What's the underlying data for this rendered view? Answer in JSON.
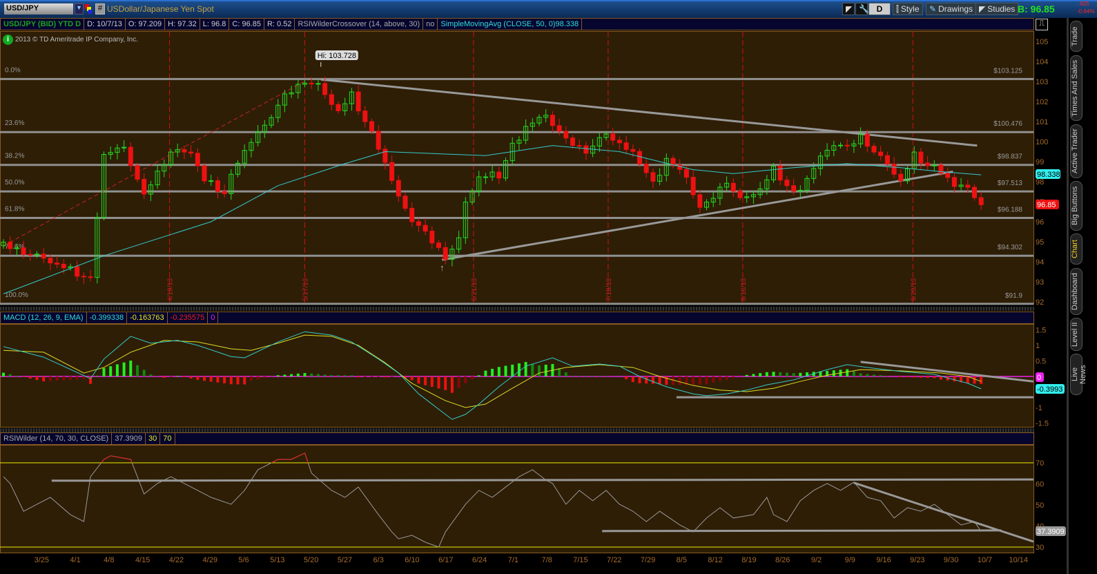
{
  "toolbar": {
    "symbol": "USD/JPY",
    "description": "USDollar/Japanese Yen Spot",
    "hash": "#",
    "period_button": "D",
    "style": "Style",
    "drawings": "Drawings",
    "studies": "Studies",
    "bid": "B: 96.85",
    "change": ".625",
    "change_pct": "-0.64%"
  },
  "info_bar": {
    "symbol": "USD/JPY (BID) YTD D",
    "date": "D: 10/7/13",
    "open": "O: 97.209",
    "high": "H: 97.32",
    "low": "L: 96.8",
    "close": "C: 96.85",
    "range": "R: 0.52",
    "study1": "RSIWilderCrossover (14, above, 30)",
    "study1_val": "no",
    "study2": "SimpleMovingAvg (CLOSE, 50, 0)98.338"
  },
  "copyright": "2013 © TD Ameritrade IP Company, Inc.",
  "side_tabs": [
    "Trade",
    "Times And Sales",
    "Active Trader",
    "Big Buttons",
    "Chart",
    "Dashboard",
    "Level II",
    "Live News"
  ],
  "colors": {
    "bg": "#2e1e06",
    "up": "#22dd22",
    "down": "#ee1111",
    "sma": "#33cccc",
    "signal": "#dddd22",
    "fib": "#909090",
    "accent": "#f0d020"
  },
  "chart_data": [
    {
      "type": "candlestick",
      "title": "USD/JPY daily",
      "ylim": [
        92,
        105
      ],
      "yticks": [
        105,
        104,
        103,
        102,
        101,
        100,
        99,
        98,
        97,
        96,
        95,
        94,
        93,
        92
      ],
      "date_labels": [
        "3/25",
        "4/1",
        "4/8",
        "4/15",
        "4/22",
        "4/29",
        "5/6",
        "5/13",
        "5/20",
        "5/27",
        "6/3",
        "6/10",
        "6/17",
        "6/24",
        "7/1",
        "7/8",
        "7/15",
        "7/22",
        "7/29",
        "8/5",
        "8/12",
        "8/19",
        "8/26",
        "9/2",
        "9/9",
        "9/16",
        "9/23",
        "9/30",
        "10/7",
        "10/14"
      ],
      "close_anchors": [
        [
          0,
          94.8
        ],
        [
          6,
          94.3
        ],
        [
          11,
          93.4
        ],
        [
          13,
          93.1
        ],
        [
          14,
          96.4
        ],
        [
          15,
          99.3
        ],
        [
          18,
          99.6
        ],
        [
          21,
          97.2
        ],
        [
          22,
          97.9
        ],
        [
          25,
          99.6
        ],
        [
          28,
          99.6
        ],
        [
          30,
          98.1
        ],
        [
          33,
          97.4
        ],
        [
          35,
          99.1
        ],
        [
          39,
          100.7
        ],
        [
          42,
          102.2
        ],
        [
          45,
          103.1
        ],
        [
          47,
          102.9
        ],
        [
          50,
          101.6
        ],
        [
          52,
          102.3
        ],
        [
          54,
          101
        ],
        [
          56,
          99.8
        ],
        [
          59,
          97.1
        ],
        [
          61,
          96
        ],
        [
          62,
          95.7
        ],
        [
          64,
          95
        ],
        [
          66,
          94.3
        ],
        [
          68,
          95.2
        ],
        [
          69,
          97.1
        ],
        [
          71,
          98.3
        ],
        [
          74,
          98.3
        ],
        [
          76,
          99.8
        ],
        [
          78,
          100.7
        ],
        [
          81,
          101.2
        ],
        [
          84,
          100
        ],
        [
          87,
          99.6
        ],
        [
          90,
          100.5
        ],
        [
          92,
          100
        ],
        [
          95,
          99
        ],
        [
          97,
          97.9
        ],
        [
          99,
          99.1
        ],
        [
          102,
          98.1
        ],
        [
          104,
          96.6
        ],
        [
          105,
          96.8
        ],
        [
          108,
          98.1
        ],
        [
          110,
          97.2
        ],
        [
          113,
          97.7
        ],
        [
          115,
          98.6
        ],
        [
          118,
          97.4
        ],
        [
          120,
          98.1
        ],
        [
          122,
          99.1
        ],
        [
          124,
          99.8
        ],
        [
          126,
          99.6
        ],
        [
          128,
          100.3
        ],
        [
          130,
          99.6
        ],
        [
          132,
          99
        ],
        [
          134,
          98.1
        ],
        [
          136,
          99.3
        ],
        [
          138,
          98.8
        ],
        [
          140,
          98.6
        ],
        [
          142,
          97.7
        ],
        [
          144,
          97.6
        ],
        [
          145,
          97.2
        ],
        [
          146,
          96.85
        ]
      ],
      "sma50_anchors": [
        [
          0,
          92.4
        ],
        [
          15,
          94.3
        ],
        [
          31,
          96
        ],
        [
          41,
          97.8
        ],
        [
          51,
          98.9
        ],
        [
          57,
          99.5
        ],
        [
          72,
          99.3
        ],
        [
          82,
          99.8
        ],
        [
          92,
          99.5
        ],
        [
          98,
          99
        ],
        [
          103,
          98.6
        ],
        [
          109,
          98.4
        ],
        [
          118,
          98.7
        ],
        [
          126,
          98.9
        ],
        [
          134,
          98.7
        ],
        [
          140,
          98.5
        ],
        [
          146,
          98.34
        ]
      ],
      "fib_levels": [
        {
          "pct": "0.0%",
          "price": 103.125,
          "label": "$103.125"
        },
        {
          "pct": "23.6%",
          "price": 100.476,
          "label": "$100.476"
        },
        {
          "pct": "38.2%",
          "price": 98.837,
          "label": "$98.837"
        },
        {
          "pct": "50.0%",
          "price": 97.513,
          "label": "$97.513"
        },
        {
          "pct": "61.8%",
          "price": 96.188,
          "label": "$96.188"
        },
        {
          "pct": "78.6%",
          "price": 94.302,
          "label": "$94.302"
        },
        {
          "pct": "100.0%",
          "price": 91.9,
          "label": "$91.9"
        }
      ],
      "month_markers": [
        {
          "day": 24.8,
          "label": "4/19/13"
        },
        {
          "day": 45,
          "label": "5/17/13"
        },
        {
          "day": 70.2,
          "label": "6/21/13"
        },
        {
          "day": 90.3,
          "label": "7/19/13"
        },
        {
          "day": 110.4,
          "label": "8/16/13"
        },
        {
          "day": 135.8,
          "label": "9/20/13"
        }
      ],
      "trendlines": [
        [
          [
            47.4,
            103.1
          ],
          [
            145.4,
            99.8
          ]
        ],
        [
          [
            65.5,
            94.1
          ],
          [
            141.8,
            98.5
          ]
        ]
      ],
      "dashed_trendline": [
        [
          0,
          94.8
        ],
        [
          44.9,
          103
        ]
      ],
      "high": {
        "day": 47.4,
        "price": 103.728,
        "label": "Hi: 103.728"
      },
      "sma_badge": "98.338",
      "last_badge": "96.85"
    },
    {
      "type": "line",
      "title": "MACD (12, 26, 9, EMA)",
      "values": [
        "-0.399338",
        "-0.163763",
        "-0.235575",
        "0"
      ],
      "ylim": [
        -1.5,
        1.5
      ],
      "yticks": [
        "1.5",
        "1",
        "0.5",
        "0",
        "-0.5",
        "-1",
        "-1.5"
      ],
      "macd_anchors": [
        [
          0,
          0.96
        ],
        [
          6,
          0.62
        ],
        [
          13,
          -0.07
        ],
        [
          15,
          0.56
        ],
        [
          19,
          1.29
        ],
        [
          22,
          1.07
        ],
        [
          26,
          1.16
        ],
        [
          29,
          1.0
        ],
        [
          34,
          0.64
        ],
        [
          36,
          0.6
        ],
        [
          41,
          1.11
        ],
        [
          45,
          1.44
        ],
        [
          49,
          1.33
        ],
        [
          52,
          1.11
        ],
        [
          56,
          0.56
        ],
        [
          59,
          0.11
        ],
        [
          62,
          -0.56
        ],
        [
          66,
          -1.22
        ],
        [
          67,
          -1.38
        ],
        [
          69,
          -1.22
        ],
        [
          71,
          -0.89
        ],
        [
          74,
          -0.33
        ],
        [
          78,
          0.33
        ],
        [
          82,
          0.6
        ],
        [
          85,
          0.33
        ],
        [
          89,
          0.4
        ],
        [
          92,
          0.33
        ],
        [
          95,
          0
        ],
        [
          99,
          -0.33
        ],
        [
          103,
          -0.56
        ],
        [
          105,
          -0.62
        ],
        [
          108,
          -0.56
        ],
        [
          111,
          -0.44
        ],
        [
          114,
          -0.27
        ],
        [
          118,
          -0.11
        ],
        [
          123,
          0.22
        ],
        [
          126,
          0.38
        ],
        [
          129,
          0.29
        ],
        [
          134,
          0.16
        ],
        [
          139,
          0.07
        ],
        [
          144,
          -0.22
        ],
        [
          146,
          -0.4
        ]
      ],
      "signal_anchors": [
        [
          0,
          0.84
        ],
        [
          6,
          0.78
        ],
        [
          12,
          0.11
        ],
        [
          15,
          0.29
        ],
        [
          19,
          0.78
        ],
        [
          24,
          1.16
        ],
        [
          29,
          1.11
        ],
        [
          34,
          0.89
        ],
        [
          37,
          0.84
        ],
        [
          41,
          1.07
        ],
        [
          45,
          1.33
        ],
        [
          49,
          1.29
        ],
        [
          53,
          1.0
        ],
        [
          57,
          0.44
        ],
        [
          61,
          -0.22
        ],
        [
          66,
          -0.78
        ],
        [
          69,
          -1.0
        ],
        [
          72,
          -0.89
        ],
        [
          76,
          -0.38
        ],
        [
          80,
          0.11
        ],
        [
          84,
          0.29
        ],
        [
          89,
          0.38
        ],
        [
          94,
          0.29
        ],
        [
          98,
          0
        ],
        [
          103,
          -0.29
        ],
        [
          107,
          -0.44
        ],
        [
          111,
          -0.49
        ],
        [
          115,
          -0.38
        ],
        [
          119,
          -0.16
        ],
        [
          123,
          0.04
        ],
        [
          128,
          0.22
        ],
        [
          134,
          0.18
        ],
        [
          140,
          0.11
        ],
        [
          144,
          0
        ],
        [
          146,
          -0.16
        ]
      ],
      "trendlines": [
        [
          [
            128,
            0.47
          ],
          [
            153.8,
            -0.16
          ]
        ],
        [
          [
            100.5,
            -0.67
          ],
          [
            153.8,
            -0.67
          ]
        ]
      ],
      "zero_badge": "0",
      "macd_badge": "-0.3993"
    },
    {
      "type": "line",
      "title": "RSIWilder (14, 70, 30, CLOSE)",
      "values": [
        "37.3909",
        "30",
        "70"
      ],
      "ylim": [
        26,
        83
      ],
      "yticks": [
        "70",
        "60",
        "50",
        "40",
        "30"
      ],
      "rsi_anchors": [
        [
          0,
          63.4
        ],
        [
          1,
          60.2
        ],
        [
          3,
          47
        ],
        [
          5,
          50.3
        ],
        [
          7,
          53.6
        ],
        [
          10,
          45.4
        ],
        [
          12,
          42.1
        ],
        [
          13,
          63.4
        ],
        [
          15,
          71.6
        ],
        [
          16,
          73.3
        ],
        [
          19,
          71.6
        ],
        [
          21,
          55.2
        ],
        [
          23,
          60.2
        ],
        [
          25,
          63.4
        ],
        [
          27,
          60.2
        ],
        [
          29,
          56.9
        ],
        [
          31,
          53.6
        ],
        [
          34,
          50.3
        ],
        [
          36,
          56.9
        ],
        [
          38,
          66.7
        ],
        [
          41,
          71.6
        ],
        [
          43,
          71.6
        ],
        [
          45,
          74.6
        ],
        [
          46,
          65.1
        ],
        [
          49,
          56.9
        ],
        [
          51,
          53.6
        ],
        [
          53,
          58.5
        ],
        [
          56,
          45.4
        ],
        [
          58,
          37.2
        ],
        [
          59,
          33.9
        ],
        [
          61,
          35.6
        ],
        [
          63,
          32.3
        ],
        [
          65,
          30
        ],
        [
          66,
          37.2
        ],
        [
          69,
          50.3
        ],
        [
          71,
          56.9
        ],
        [
          73,
          53.6
        ],
        [
          75,
          58.5
        ],
        [
          77,
          63.4
        ],
        [
          79,
          66.7
        ],
        [
          81,
          61.8
        ],
        [
          82,
          60.2
        ],
        [
          84,
          50.3
        ],
        [
          86,
          56.9
        ],
        [
          88,
          52
        ],
        [
          90,
          56.9
        ],
        [
          92,
          50.3
        ],
        [
          94,
          47
        ],
        [
          96,
          42.1
        ],
        [
          98,
          47
        ],
        [
          101,
          40.5
        ],
        [
          103,
          37.2
        ],
        [
          105,
          43.8
        ],
        [
          107,
          48.7
        ],
        [
          109,
          43.8
        ],
        [
          112,
          45.4
        ],
        [
          114,
          53.6
        ],
        [
          115,
          45.4
        ],
        [
          117,
          42.1
        ],
        [
          119,
          52
        ],
        [
          121,
          56.9
        ],
        [
          123,
          60.2
        ],
        [
          125,
          56.9
        ],
        [
          127,
          60.8
        ],
        [
          129,
          53.6
        ],
        [
          131,
          52
        ],
        [
          133,
          43.8
        ],
        [
          135,
          48.7
        ],
        [
          137,
          47
        ],
        [
          139,
          50.3
        ],
        [
          141,
          45.4
        ],
        [
          143,
          40.5
        ],
        [
          145,
          42.1
        ],
        [
          146,
          37.4
        ]
      ],
      "trendlines": [
        [
          [
            7.2,
            61.5
          ],
          [
            153.8,
            62.1
          ]
        ],
        [
          [
            127,
            60.5
          ],
          [
            153.8,
            32.6
          ]
        ],
        [
          [
            89.4,
            37.6
          ],
          [
            149,
            37.9
          ]
        ]
      ],
      "rsi_badge": "37.3909"
    }
  ]
}
